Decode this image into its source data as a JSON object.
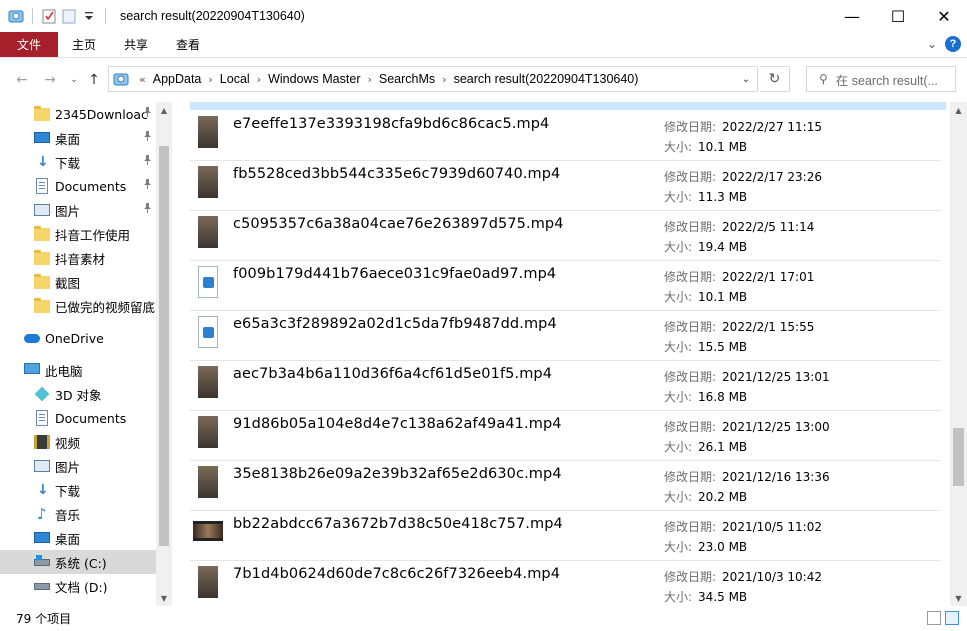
{
  "window": {
    "title": "search result(20220904T130640)",
    "minimize": "—",
    "maximize": "☐",
    "close": "✕"
  },
  "ribbon": {
    "tabs": [
      {
        "label": "文件"
      },
      {
        "label": "主页"
      },
      {
        "label": "共享"
      },
      {
        "label": "查看"
      }
    ],
    "collapse": "⌄",
    "help": "?"
  },
  "address": {
    "overflow": "«",
    "crumbs": [
      "AppData",
      "Local",
      "Windows Master",
      "SearchMs",
      "search result(20220904T130640)"
    ],
    "separator": "›",
    "dropdown": "⌄",
    "refresh": "↻",
    "search_placeholder": "在 search result(..."
  },
  "nav_buttons": {
    "back": "←",
    "forward": "→",
    "history": "⌄",
    "up": "↑"
  },
  "sidebar": {
    "items": [
      {
        "label": "2345Downloac",
        "icon": "folder-icon",
        "pinned": true
      },
      {
        "label": "桌面",
        "icon": "desktop-icon",
        "pinned": true
      },
      {
        "label": "下载",
        "icon": "download-icon",
        "pinned": true
      },
      {
        "label": "Documents",
        "icon": "documents-icon",
        "pinned": true
      },
      {
        "label": "图片",
        "icon": "pictures-icon",
        "pinned": true
      },
      {
        "label": "抖音工作使用",
        "icon": "folder-icon",
        "pinned": false
      },
      {
        "label": "抖音素材",
        "icon": "folder-icon",
        "pinned": false
      },
      {
        "label": "截图",
        "icon": "folder-icon",
        "pinned": false
      },
      {
        "label": "已做完的视频留底",
        "icon": "folder-icon",
        "pinned": false
      },
      {
        "label": "OneDrive",
        "icon": "onedrive-icon",
        "pinned": false
      },
      {
        "label": "此电脑",
        "icon": "this-pc-icon",
        "pinned": false
      },
      {
        "label": "3D 对象",
        "icon": "3d-objects-icon",
        "pinned": false
      },
      {
        "label": "Documents",
        "icon": "documents-icon",
        "pinned": false
      },
      {
        "label": "视频",
        "icon": "videos-icon",
        "pinned": false
      },
      {
        "label": "图片",
        "icon": "pictures-icon",
        "pinned": false
      },
      {
        "label": "下载",
        "icon": "download-icon",
        "pinned": false
      },
      {
        "label": "音乐",
        "icon": "music-icon",
        "pinned": false
      },
      {
        "label": "桌面",
        "icon": "desktop-icon",
        "pinned": false
      },
      {
        "label": "系统 (C:)",
        "icon": "system-drive-icon",
        "pinned": false,
        "selected": true
      },
      {
        "label": "文档 (D:)",
        "icon": "drive-icon",
        "pinned": false
      }
    ],
    "pin_glyph": "📌"
  },
  "files": {
    "date_label": "修改日期:",
    "size_label": "大小:",
    "rows": [
      {
        "name": "e7eeffe137e3393198cfa9bd6c86cac5.mp4",
        "date": "2022/2/27 11:15",
        "size": "10.1 MB",
        "thumb": "image"
      },
      {
        "name": "fb5528ced3bb544c335e6c7939d60740.mp4",
        "date": "2022/2/17 23:26",
        "size": "11.3 MB",
        "thumb": "image"
      },
      {
        "name": "c5095357c6a38a04cae76e263897d575.mp4",
        "date": "2022/2/5 11:14",
        "size": "19.4 MB",
        "thumb": "image"
      },
      {
        "name": "f009b179d441b76aece031c9fae0ad97.mp4",
        "date": "2022/2/1 17:01",
        "size": "10.1 MB",
        "thumb": "file"
      },
      {
        "name": "e65a3c3f289892a02d1c5da7fb9487dd.mp4",
        "date": "2022/2/1 15:55",
        "size": "15.5 MB",
        "thumb": "file"
      },
      {
        "name": "aec7b3a4b6a110d36f6a4cf61d5e01f5.mp4",
        "date": "2021/12/25 13:01",
        "size": "16.8 MB",
        "thumb": "image"
      },
      {
        "name": "91d86b05a104e8d4e7c138a62af49a41.mp4",
        "date": "2021/12/25 13:00",
        "size": "26.1 MB",
        "thumb": "image"
      },
      {
        "name": "35e8138b26e09a2e39b32af65e2d630c.mp4",
        "date": "2021/12/16 13:36",
        "size": "20.2 MB",
        "thumb": "image"
      },
      {
        "name": "bb22abdcc67a3672b7d38c50e418c757.mp4",
        "date": "2021/10/5 11:02",
        "size": "23.0 MB",
        "thumb": "wide"
      },
      {
        "name": "7b1d4b0624d60de7c8c6c26f7326eeb4.mp4",
        "date": "2021/10/3 10:42",
        "size": "34.5 MB",
        "thumb": "image"
      }
    ]
  },
  "status": {
    "count": "79 个项目"
  },
  "colors": {
    "file_tab": "#a5202a",
    "selection": "#cce8ff",
    "accent": "#1a6fd3"
  }
}
